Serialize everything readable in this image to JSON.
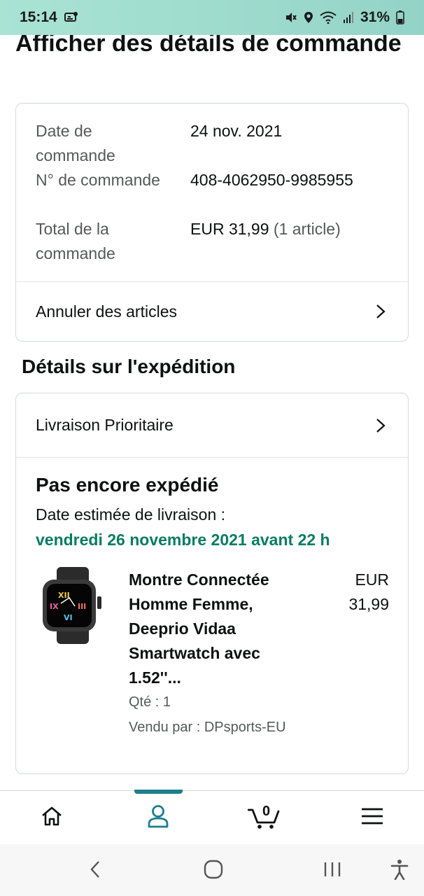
{
  "status_bar": {
    "time": "15:14",
    "battery": "31%"
  },
  "page": {
    "title": "Afficher des détails de commande"
  },
  "order_summary": {
    "rows": [
      {
        "label": "Date de commande",
        "value": "24 nov. 2021",
        "extra": ""
      },
      {
        "label": "N° de commande",
        "value": "408-4062950-9985955",
        "extra": ""
      },
      {
        "label": "Total de la commande",
        "value": "EUR 31,99",
        "extra": " (1 article)"
      }
    ],
    "cancel_link": "Annuler des articles"
  },
  "shipping": {
    "section_title": "Détails sur l'expédition",
    "delivery_option": "Livraison Prioritaire",
    "status": "Pas encore expédié",
    "estimate_label": "Date estimée de livraison :",
    "estimate_date": "vendredi 26 novembre 2021 avant 22 h",
    "product": {
      "title": "Montre Connectée Homme Femme, Deeprio Vidaa Smartwatch avec 1.52''...",
      "price": "EUR 31,99",
      "quantity": "Qté : 1",
      "seller": "Vendu par : DPsports-EU"
    }
  },
  "bottom_nav": {
    "items": [
      "home-icon",
      "account-icon",
      "cart-icon",
      "menu-icon"
    ],
    "active": "account-icon",
    "cart_count": "0"
  },
  "colors": {
    "accent": "#1b7f8e",
    "success": "#067d62",
    "border": "#d5d9d9"
  }
}
